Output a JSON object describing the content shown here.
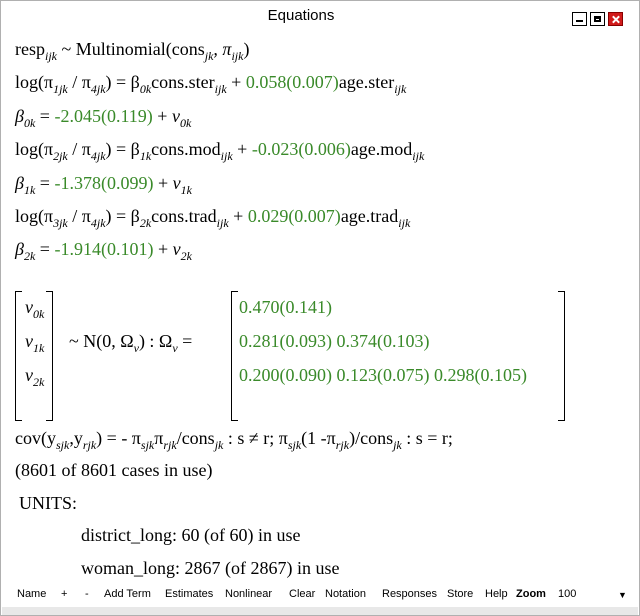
{
  "window": {
    "title": "Equations"
  },
  "equations": {
    "resp": {
      "left": "resp",
      "sub": "ijk",
      "rest": " ~ Multinomial(cons",
      "cons_sub": "jk",
      "pi": ", π",
      "pi_sub": "ijk",
      "close": ")"
    },
    "log1": {
      "pre": "log(π",
      "s1": "1jk",
      "mid": " / π",
      "s2": "4jk",
      "eq": ") = β",
      "b": "0k",
      "term": "cons.ster",
      "t_sub": "ijk",
      "plus": " + ",
      "coef": "0.058(0.007)",
      "var": "age.ster",
      "v_sub": "ijk"
    },
    "beta0": {
      "b": "β",
      "bs": "0k",
      "eq": " = ",
      "val": "-2.045(0.119)",
      "plus": " + ",
      "v": "v",
      "vs": "0k"
    },
    "log2": {
      "pre": "log(π",
      "s1": "2jk",
      "mid": " / π",
      "s2": "4jk",
      "eq": ") = β",
      "b": "1k",
      "term": "cons.mod",
      "t_sub": "ijk",
      "plus": " + ",
      "coef": "-0.023(0.006)",
      "var": "age.mod",
      "v_sub": "ijk"
    },
    "beta1": {
      "b": "β",
      "bs": "1k",
      "eq": " = ",
      "val": "-1.378(0.099)",
      "plus": " + ",
      "v": "v",
      "vs": "1k"
    },
    "log3": {
      "pre": "log(π",
      "s1": "3jk",
      "mid": " / π",
      "s2": "4jk",
      "eq": ") = β",
      "b": "2k",
      "term": "cons.trad",
      "t_sub": "ijk",
      "plus": " + ",
      "coef": "0.029(0.007)",
      "var": "age.trad",
      "v_sub": "ijk"
    },
    "beta2": {
      "b": "β",
      "bs": "2k",
      "eq": " = ",
      "val": "-1.914(0.101)",
      "plus": " + ",
      "v": "v",
      "vs": "2k"
    }
  },
  "matrix": {
    "vec": [
      {
        "v": "v",
        "s": "0k"
      },
      {
        "v": "v",
        "s": "1k"
      },
      {
        "v": "v",
        "s": "2k"
      }
    ],
    "dist": "~ N(0,  Ω",
    "dist_sub": "v",
    "dist_close": ")  :  Ω",
    "omega_sub": "v",
    "eq": " =",
    "row1": [
      "0.470(0.141)"
    ],
    "row2": [
      "0.281(0.093)",
      "0.374(0.103)"
    ],
    "row3": [
      "0.200(0.090)",
      "0.123(0.075)",
      "0.298(0.105)"
    ]
  },
  "cov": {
    "a": "cov(y",
    "as": "sjk",
    "b": ",y",
    "bs": "rjk",
    "c": ") = - π",
    "cs": "sjk",
    "d": "π",
    "ds": "rjk",
    "e": "/cons",
    "es": "jk",
    "f": " : s ≠ r;    π",
    "fs": "sjk",
    "g": "(1 -π",
    "gs": "rjk",
    "h": ")/cons",
    "hs": "jk",
    "i": " : s = r;"
  },
  "cases": "(8601 of 8601 cases in use)",
  "units": {
    "label": "UNITS:",
    "district": "district_long: 60 (of 60) in use",
    "woman": "woman_long: 2867 (of 2867) in use"
  },
  "toolbar": {
    "name": "Name",
    "plus": "+",
    "minus": "-",
    "add_term": "Add Term",
    "estimates": "Estimates",
    "nonlinear": "Nonlinear",
    "clear": "Clear",
    "notation": "Notation",
    "responses": "Responses",
    "store": "Store",
    "help": "Help",
    "zoom": "Zoom",
    "zoom_value": "100"
  },
  "colors": {
    "estimate": "#3a8a2a",
    "close_button": "#d11b1b"
  }
}
